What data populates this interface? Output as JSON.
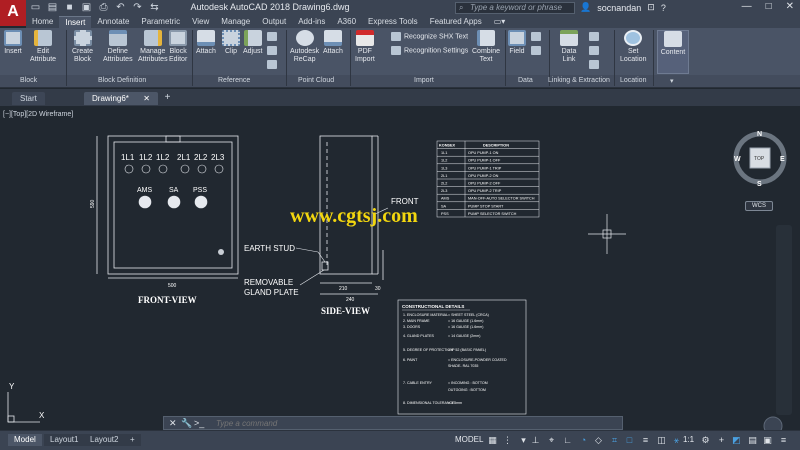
{
  "app": {
    "logo": "A",
    "title": "Autodesk AutoCAD 2018    Drawing6.dwg",
    "search_placeholder": "Type a keyword or phrase",
    "user": "socnandan",
    "qat_icons": [
      "new-icon",
      "open-icon",
      "save-icon",
      "save-as-icon",
      "print-icon",
      "undo-icon",
      "redo-icon",
      "share-icon"
    ],
    "window_controls": {
      "minimize": "—",
      "maximize": "□",
      "close": "✕"
    }
  },
  "ribbon": {
    "tabs": [
      "Home",
      "Insert",
      "Annotate",
      "Parametric",
      "View",
      "Manage",
      "Output",
      "Add-ins",
      "A360",
      "Express Tools",
      "Featured Apps"
    ],
    "active_tab": "Insert",
    "buttons": {
      "insert": "Insert",
      "edit_attribute": [
        "Edit",
        "Attribute"
      ],
      "create_block": [
        "Create",
        "Block"
      ],
      "define_attributes": [
        "Define",
        "Attributes"
      ],
      "manage_attributes": [
        "Manage",
        "Attributes"
      ],
      "block_editor": [
        "Block",
        "Editor"
      ],
      "attach": "Attach",
      "clip": "Clip",
      "adjust": "Adjust",
      "recap": [
        "Autodesk",
        "ReCap"
      ],
      "pc_attach": "Attach",
      "pdf_import": [
        "PDF",
        "Import"
      ],
      "recognize_shx": "Recognize SHX Text",
      "recognition_settings": "Recognition Settings",
      "combine_text": [
        "Combine",
        "Text"
      ],
      "field": "Field",
      "data_link": [
        "Data",
        "Link"
      ],
      "set_location": [
        "Set",
        "Location"
      ],
      "content": "Content"
    },
    "panels": [
      "Block",
      "Block Definition",
      "Reference",
      "Point Cloud",
      "Import",
      "Data",
      "Linking & Extraction",
      "Location"
    ]
  },
  "doc_tabs": {
    "start": "Start",
    "drawing": "Drawing6*"
  },
  "viewport": {
    "label": "[−][Top][2D Wireframe]",
    "viewcube": {
      "north": "N",
      "south": "S",
      "east": "E",
      "west": "W",
      "face": "TOP",
      "ucs": "WCS"
    },
    "ucs_axes": {
      "x": "X",
      "y": "Y"
    }
  },
  "drawing": {
    "front_view": {
      "title": "FRONT-VIEW",
      "width_dim": "500",
      "height_dim": "590",
      "indicator_labels": [
        "1L1",
        "1L2",
        "1L2",
        "2L1",
        "2L2",
        "2L3"
      ],
      "switch_labels": [
        "AMS",
        "SA",
        "PSS"
      ]
    },
    "side_view": {
      "title": "SIDE-VIEW",
      "dim_top": "210",
      "dim_right": "30",
      "dim_bottom": "240"
    },
    "callouts": {
      "front": "FRONT",
      "earth_stud": "EARTH STUD",
      "gland_line1": "REMOVABLE",
      "gland_line2": "GLAND PLATE"
    },
    "legend_table": {
      "headers": [
        "KONSEX",
        "DESCRIPTION"
      ],
      "rows": [
        [
          "1L1",
          "OPU PUMP-1 ON"
        ],
        [
          "1L2",
          "OPU PUMP-1 OFF"
        ],
        [
          "1L3",
          "OPU PUMP-1 TRIP"
        ],
        [
          "2L1",
          "OPU PUMP-2 ON"
        ],
        [
          "2L2",
          "OPU PUMP-2 OFF"
        ],
        [
          "2L3",
          "OPU PUMP-2 TRIP"
        ],
        [
          "AMS",
          "MAN-OFF-AUTO SELECTOR SWITCH"
        ],
        [
          "SA",
          "PUMP STOP START"
        ],
        [
          "PSS",
          "PUMP SELECTOR SWITCH"
        ]
      ]
    },
    "construction_details": {
      "title": "CONSTRUCTIONAL DETAILS",
      "rows": [
        [
          "1. ENCLOSURE MATERIAL",
          "SHEET STEEL (CRCA)"
        ],
        [
          "2. MAIN FRAME",
          "16 GAUGE (1.6mm)"
        ],
        [
          "3. DOORS",
          "16 GAUGE (1.6mm)"
        ],
        [
          "4. GLAND PLATES",
          "14 GAUGE (2mm)"
        ],
        [
          "5. DEGREE OF PROTECTION",
          "IP 52  (BASIC PANEL)"
        ],
        [
          "6. PAINT",
          "ENCLOSURE-POWDER COATED"
        ],
        [
          "",
          "SHADE- RAL 7035"
        ],
        [
          "7. CABLE ENTRY",
          "INCOMING : BOTTOM"
        ],
        [
          "",
          "OUTGOING : BOTTOM"
        ],
        [
          "8. DIMENSIONAL TOLERANCE",
          "± 5mm"
        ]
      ]
    },
    "watermark": "www.cgtsj.com"
  },
  "command_line": {
    "placeholder": "Type a command",
    "prompt": ">_"
  },
  "status_bar": {
    "layout_tabs": [
      "Model",
      "Layout1",
      "Layout2"
    ],
    "active_layout": "Model",
    "add_tab": "+",
    "model_button": "MODEL",
    "scale": "1:1"
  }
}
